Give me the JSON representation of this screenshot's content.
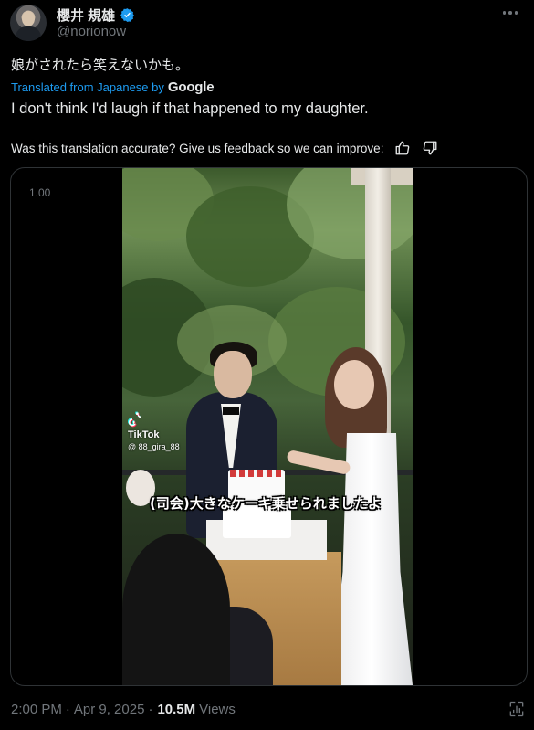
{
  "author": {
    "display_name": "櫻井 規雄",
    "handle": "@norionow",
    "verified": true,
    "avatar": "avatar-photo"
  },
  "tweet": {
    "text": "娘がされたら笑えないかも。",
    "translated_label": "Translated from Japanese by",
    "translator_logo": "Google",
    "translation": "I don't think I'd laugh if that happened to my daughter.",
    "feedback_prompt": "Was this translation accurate? Give us feedback so we can improve:",
    "feedback_icons": [
      "thumbs-up-icon",
      "thumbs-down-icon"
    ]
  },
  "media": {
    "playback_speed": "1.00",
    "watermark_app": "TikTok",
    "watermark_user": "@ 88_gira_88",
    "caption": "(司会)大きなケーキ乗せられましたよ"
  },
  "meta": {
    "time": "2:00 PM",
    "separator": "·",
    "date": "Apr 9, 2025",
    "views_count": "10.5M",
    "views_label": "Views"
  },
  "colors": {
    "background": "#000000",
    "text_primary": "#e7e9ea",
    "text_secondary": "#71767b",
    "accent": "#1d9bf0",
    "border": "#2f3336"
  }
}
